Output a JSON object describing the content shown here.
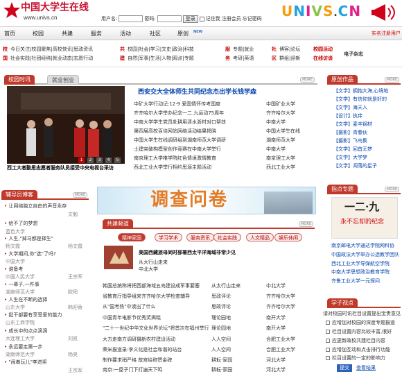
{
  "header": {
    "site_name": "中国大学生在线",
    "site_url": "www.univs.cn",
    "brand": "UNIVS.CN",
    "login": {
      "user_label": "用户名:",
      "pass_label": "密码:",
      "login_btn": "登录",
      "remember": "记住我",
      "register": "注册会员",
      "forgot": "忘记密码"
    }
  },
  "nav": {
    "items": [
      "首页",
      "校园",
      "共建",
      "服务",
      "活动",
      "社区",
      "原创"
    ],
    "new_badge": "NEW",
    "right_link": "实名注册用户"
  },
  "cats": {
    "g1": {
      "label": "校",
      "rows": [
        "今日关注|校园聚焦|高校快讯|思政资讯",
        "国",
        "社会实践|社团经纬|就业动态|志愿行动"
      ]
    },
    "g2": {
      "label": "共",
      "rows": [
        "校园|社会|学习|文史|政治|科技",
        "建",
        "自然|军事|生活|人物|观点|专题"
      ]
    },
    "g3": {
      "label": "服",
      "rows": [
        "专题|就业",
        "务",
        "考研|英语"
      ]
    },
    "g4": {
      "label": "社",
      "rows": [
        "博客|论坛",
        "区",
        "群组|迎新"
      ]
    },
    "g5": {
      "rows": [
        "校园活动",
        "在线访谈"
      ]
    },
    "ezine": "电子杂志"
  },
  "campus": {
    "tab_on": "校园时讯",
    "tab_off": "就业创业",
    "more": "MORE",
    "pages": [
      "1",
      "2",
      "3",
      "4",
      "5"
    ],
    "photo_caption": "西工大者勤思志愿者服务队员接受中央电视台采访"
  },
  "news": {
    "headline": "西安交大全体师生共同纪念杰出学长钱学森",
    "items": [
      {
        "title": "中矿大学行动记:12·9 爱国情怀传考国度",
        "source": "中国矿业大学"
      },
      {
        "title": "齐齐哈尔大学举办纪念一二.九运动75周年",
        "source": "齐齐哈尔大学"
      },
      {
        "title": "中南大学学生党员赴耕用清水浙村对口帮扶",
        "source": "中南大学"
      },
      {
        "title": "第四届高校百佳网站网络活动结果揭晓",
        "source": "中国大学生在线"
      },
      {
        "title": "中国大学生在线调研组到湖南师范大学调研",
        "source": "湖南师范大学"
      },
      {
        "title": "土建突破构模型创作竞赛在中南大学举行",
        "source": "中南大学"
      },
      {
        "title": "南京理工大学推学院红色情境激情教育",
        "source": "南京理工大学"
      },
      {
        "title": "西北工业大学举行相约思源主题活动",
        "source": "西北工业大学"
      }
    ]
  },
  "original": {
    "title": "原创作品",
    "more": "MORE",
    "items": [
      {
        "cat": "【文学】",
        "title": "拥抱大海,心境地"
      },
      {
        "cat": "【文学】",
        "title": "有信仰就是好的"
      },
      {
        "cat": "【文学】",
        "title": "海天人"
      },
      {
        "cat": "【设计】",
        "title": "执痒"
      },
      {
        "cat": "【文学】",
        "title": "麦丰钢材"
      },
      {
        "cat": "【摄影】",
        "title": "青春伙"
      },
      {
        "cat": "【摄影】",
        "title": "飞鸟集"
      },
      {
        "cat": "【文学】",
        "title": "回首无梦"
      },
      {
        "cat": "【文学】",
        "title": "大学梦"
      },
      {
        "cat": "【文学】",
        "title": "凋落的星子"
      }
    ]
  },
  "counselor": {
    "title": "辅导员博客",
    "more": "MORE",
    "items": [
      {
        "title": "让网络独立自由的声音永存",
        "author": "文勉"
      },
      {
        "title": "给不了的梦想",
        "author": "蓝色大学"
      },
      {
        "title": "人生,\"掉马都是择生\"",
        "author": "杨文霞"
      },
      {
        "title": "大学期间,你\"选\"了吗?",
        "author": "中国大学"
      },
      {
        "title": "谁备考",
        "author": "中国人民大学"
      },
      {
        "title": "一辈子,一件事",
        "author": "湖南师范大学"
      },
      {
        "title": "人生在不断的选择",
        "author": "山东大学"
      },
      {
        "title": "挺干部要有享受爱的能力",
        "author": "山东工商学院"
      },
      {
        "title": "成长中的点点滴滴",
        "author": "大连理工大学"
      },
      {
        "title": "永远要走第一步",
        "author": "湖南师范大学"
      },
      {
        "title": "\"闹着玩儿\"李进奖",
        "author": "王宗军"
      }
    ],
    "authors_right": [
      "文勉",
      "",
      "杨文霞",
      "",
      "王宗军",
      "欧阳",
      "韩迎香",
      "",
      "刘凯",
      "杨昊",
      "王宗军"
    ]
  },
  "ad": {
    "text": "调查问卷"
  },
  "joint": {
    "title": "共建频道",
    "more": "MORE",
    "pills": [
      "精神家园",
      "学习学术",
      "服务资讯",
      "社会实践",
      "人文精品",
      "娱乐休闲"
    ],
    "feature_title": "美国西藏旅母同时部署西太平洋海域非常少见",
    "feature_source": "从大行山走来",
    "feature_school": "中北大学",
    "items": [
      {
        "title": "韩国总统称将把西部海域五岛建设成军事要塞",
        "cat": "从太行山走来",
        "school": "中北大学"
      },
      {
        "title": "省教育厅指导组来齐齐哈尔大学检查辅导",
        "cat": "思政评论",
        "school": "齐齐哈尔大学"
      },
      {
        "title": "从\"国考热\"中读出了什么",
        "cat": "思政评论",
        "school": "齐齐哈尔大学"
      },
      {
        "title": "中国青年电影节优秀奖揭晓",
        "cat": "理论园地",
        "school": "南开大学"
      },
      {
        "title": "\"二十一世纪中华文化世界论坛\"将首次在福州举行",
        "cat": "理论园地",
        "school": "南开大学"
      },
      {
        "title": "大方走南方调研摄新农村建设活动",
        "cat": "人人空间",
        "school": "合肥工业大学"
      },
      {
        "title": "荣米报道录:李义化是社会和谐的站台",
        "cat": "人人空间",
        "school": "合肥工业大学"
      },
      {
        "title": "制作要求稍严格 故宫给称赞金碑",
        "cat": "耕耘·家园",
        "school": "河北大学"
      },
      {
        "title": "南京:一屋子门下打遍天下鸣",
        "cat": "耕耘·家园",
        "school": "河北大学"
      }
    ]
  },
  "topic": {
    "title": "指点专题",
    "more": "MORE",
    "banner_text": "一二·九",
    "banner_sub": "永不忘却的纪念",
    "items": [
      "南京邮电大学通达学院网科协",
      "中国政法大学举办公选教学团队",
      "西北工业大学导弹航空学院",
      "中南大学思想政治教育学院",
      "齐鲁工业大学一元探问",
      "齐鲁大学一元探问部"
    ]
  },
  "poll": {
    "title": "学子视点",
    "question": "请对校园时讯栏目设置提出宝贵意见",
    "options": [
      "应增加对校园的深度专题报道",
      "栏目设置内容比较丰富,很好",
      "应更新政校共建栏目内容",
      "应增加互动和点击排行功能",
      "栏目设置的一定的影响力"
    ],
    "submit": "提交",
    "results": "查看结果"
  }
}
